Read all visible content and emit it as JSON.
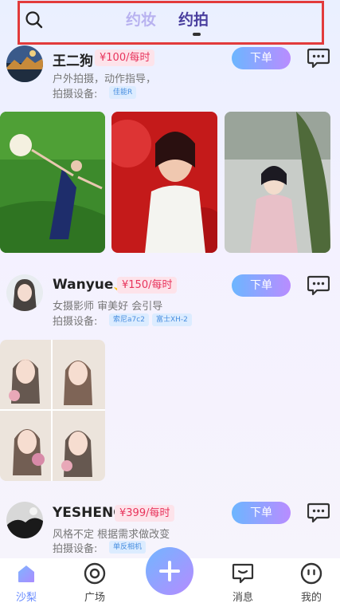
{
  "header": {
    "tabs": [
      {
        "label": "约妆",
        "active": false
      },
      {
        "label": "约拍",
        "active": true
      }
    ],
    "search_icon": "search-icon",
    "highlight_color": "#e23b3b"
  },
  "posts": [
    {
      "name": "王二狗",
      "price": "¥100/每时",
      "description": "户外拍摄，动作指导，",
      "equipment_label": "拍摄设备:",
      "equipment_tags": [
        "佳能R"
      ],
      "order_label": "下单"
    },
    {
      "name": "Wanyue🌙",
      "price": "¥150/每时",
      "description": "女摄影师 审美好 会引导",
      "equipment_label": "拍摄设备:",
      "equipment_tags": [
        "索尼a7c2",
        "富士XH-2"
      ],
      "order_label": "下单"
    },
    {
      "name": "YESHENG",
      "price": "¥399/每时",
      "description": "风格不定 根据需求做改变",
      "equipment_label": "拍摄设备:",
      "equipment_tags": [
        "单反相机"
      ],
      "order_label": "下单"
    }
  ],
  "bottom_nav": [
    {
      "label": "沙梨",
      "icon": "home-icon",
      "active": true
    },
    {
      "label": "广场",
      "icon": "target-icon",
      "active": false
    },
    {
      "label": "",
      "icon": "plus-icon",
      "active": false
    },
    {
      "label": "消息",
      "icon": "message-icon",
      "active": false
    },
    {
      "label": "我的",
      "icon": "face-icon",
      "active": false
    }
  ],
  "colors": {
    "accent_purple": "#4a3f9e",
    "price_red": "#e8345c",
    "tag_blue": "#4a8fe0",
    "button_gradient_start": "#6cb6ff",
    "button_gradient_end": "#b98cff"
  }
}
